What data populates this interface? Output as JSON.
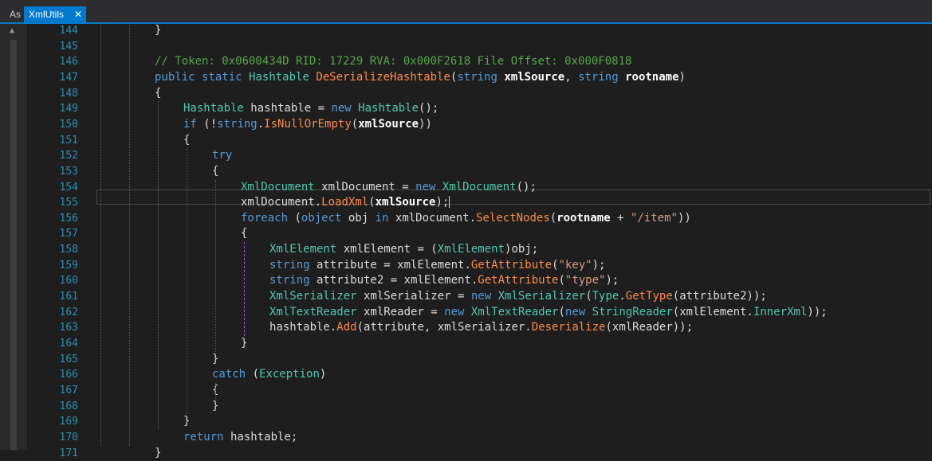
{
  "tabs": [
    {
      "label": "As",
      "active": false
    },
    {
      "label": "XmlUtils",
      "active": true
    }
  ],
  "tab_close_glyph": "✕",
  "colors": {
    "accent": "#007acc",
    "line_number": "#2b91af",
    "keyword": "#569cd6",
    "type": "#4ec9b0",
    "method": "#ff8c4b",
    "string": "#d69d85",
    "comment": "#57a64a"
  },
  "editor": {
    "current_line": 155,
    "lines": [
      {
        "n": "144",
        "indent": 2,
        "tokens": [
          [
            "p",
            "}"
          ]
        ]
      },
      {
        "n": "145",
        "indent": 0,
        "tokens": []
      },
      {
        "n": "146",
        "indent": 2,
        "tokens": [
          [
            "c",
            "// Token: 0x0600434D RID: 17229 RVA: 0x000F2618 File Offset: 0x000F0818"
          ]
        ]
      },
      {
        "n": "147",
        "indent": 2,
        "tokens": [
          [
            "k",
            "public"
          ],
          [
            "p",
            " "
          ],
          [
            "k",
            "static"
          ],
          [
            "p",
            " "
          ],
          [
            "t",
            "Hashtable"
          ],
          [
            "p",
            " "
          ],
          [
            "m",
            "DeSerializeHashtable"
          ],
          [
            "p",
            "("
          ],
          [
            "k",
            "string"
          ],
          [
            "p",
            " "
          ],
          [
            "b",
            "xmlSource"
          ],
          [
            "p",
            ", "
          ],
          [
            "k",
            "string"
          ],
          [
            "p",
            " "
          ],
          [
            "b",
            "rootname"
          ],
          [
            "p",
            ")"
          ]
        ]
      },
      {
        "n": "148",
        "indent": 2,
        "tokens": [
          [
            "p",
            "{"
          ]
        ]
      },
      {
        "n": "149",
        "indent": 3,
        "tokens": [
          [
            "t",
            "Hashtable"
          ],
          [
            "p",
            " hashtable = "
          ],
          [
            "k",
            "new"
          ],
          [
            "p",
            " "
          ],
          [
            "t",
            "Hashtable"
          ],
          [
            "p",
            "();"
          ]
        ]
      },
      {
        "n": "150",
        "indent": 3,
        "tokens": [
          [
            "k",
            "if"
          ],
          [
            "p",
            " (!"
          ],
          [
            "k",
            "string"
          ],
          [
            "p",
            "."
          ],
          [
            "m",
            "IsNullOrEmpty"
          ],
          [
            "p",
            "("
          ],
          [
            "b",
            "xmlSource"
          ],
          [
            "p",
            "))"
          ]
        ]
      },
      {
        "n": "151",
        "indent": 3,
        "tokens": [
          [
            "p",
            "{"
          ]
        ]
      },
      {
        "n": "152",
        "indent": 4,
        "tokens": [
          [
            "k",
            "try"
          ]
        ]
      },
      {
        "n": "153",
        "indent": 4,
        "tokens": [
          [
            "p",
            "{"
          ]
        ]
      },
      {
        "n": "154",
        "indent": 5,
        "tokens": [
          [
            "t",
            "XmlDocument"
          ],
          [
            "p",
            " xmlDocument = "
          ],
          [
            "k",
            "new"
          ],
          [
            "p",
            " "
          ],
          [
            "t",
            "XmlDocument"
          ],
          [
            "p",
            "();"
          ]
        ]
      },
      {
        "n": "155",
        "indent": 5,
        "tokens": [
          [
            "p",
            "xmlDocument."
          ],
          [
            "m",
            "LoadXml"
          ],
          [
            "p",
            "("
          ],
          [
            "b",
            "xmlSource"
          ],
          [
            "p",
            ");"
          ]
        ]
      },
      {
        "n": "156",
        "indent": 5,
        "tokens": [
          [
            "k",
            "foreach"
          ],
          [
            "p",
            " ("
          ],
          [
            "k",
            "object"
          ],
          [
            "p",
            " obj "
          ],
          [
            "k",
            "in"
          ],
          [
            "p",
            " xmlDocument."
          ],
          [
            "m",
            "SelectNodes"
          ],
          [
            "p",
            "("
          ],
          [
            "b",
            "rootname"
          ],
          [
            "p",
            " + "
          ],
          [
            "s",
            "\"/item\""
          ],
          [
            "p",
            "))"
          ]
        ]
      },
      {
        "n": "157",
        "indent": 5,
        "tokens": [
          [
            "p",
            "{"
          ]
        ]
      },
      {
        "n": "158",
        "indent": 6,
        "tokens": [
          [
            "t",
            "XmlElement"
          ],
          [
            "p",
            " xmlElement = ("
          ],
          [
            "t",
            "XmlElement"
          ],
          [
            "p",
            ")obj;"
          ]
        ]
      },
      {
        "n": "159",
        "indent": 6,
        "tokens": [
          [
            "k",
            "string"
          ],
          [
            "p",
            " attribute = xmlElement."
          ],
          [
            "m",
            "GetAttribute"
          ],
          [
            "p",
            "("
          ],
          [
            "s",
            "\"key\""
          ],
          [
            "p",
            ");"
          ]
        ]
      },
      {
        "n": "160",
        "indent": 6,
        "tokens": [
          [
            "k",
            "string"
          ],
          [
            "p",
            " attribute2 = xmlElement."
          ],
          [
            "m",
            "GetAttribute"
          ],
          [
            "p",
            "("
          ],
          [
            "s",
            "\"type\""
          ],
          [
            "p",
            ");"
          ]
        ]
      },
      {
        "n": "161",
        "indent": 6,
        "tokens": [
          [
            "t",
            "XmlSerializer"
          ],
          [
            "p",
            " xmlSerializer = "
          ],
          [
            "k",
            "new"
          ],
          [
            "p",
            " "
          ],
          [
            "t",
            "XmlSerializer"
          ],
          [
            "p",
            "("
          ],
          [
            "t",
            "Type"
          ],
          [
            "p",
            "."
          ],
          [
            "m",
            "GetType"
          ],
          [
            "p",
            "(attribute2));"
          ]
        ]
      },
      {
        "n": "162",
        "indent": 6,
        "tokens": [
          [
            "t",
            "XmlTextReader"
          ],
          [
            "p",
            " xmlReader = "
          ],
          [
            "k",
            "new"
          ],
          [
            "p",
            " "
          ],
          [
            "t",
            "XmlTextReader"
          ],
          [
            "p",
            "("
          ],
          [
            "k",
            "new"
          ],
          [
            "p",
            " "
          ],
          [
            "t",
            "StringReader"
          ],
          [
            "p",
            "(xmlElement."
          ],
          [
            "r",
            "InnerXml"
          ],
          [
            "p",
            "));"
          ]
        ]
      },
      {
        "n": "163",
        "indent": 6,
        "tokens": [
          [
            "p",
            "hashtable."
          ],
          [
            "m",
            "Add"
          ],
          [
            "p",
            "(attribute, xmlSerializer."
          ],
          [
            "m",
            "Deserialize"
          ],
          [
            "p",
            "(xmlReader));"
          ]
        ]
      },
      {
        "n": "164",
        "indent": 5,
        "tokens": [
          [
            "p",
            "}"
          ]
        ]
      },
      {
        "n": "165",
        "indent": 4,
        "tokens": [
          [
            "p",
            "}"
          ]
        ]
      },
      {
        "n": "166",
        "indent": 4,
        "tokens": [
          [
            "k",
            "catch"
          ],
          [
            "p",
            " ("
          ],
          [
            "t",
            "Exception"
          ],
          [
            "p",
            ")"
          ]
        ]
      },
      {
        "n": "167",
        "indent": 4,
        "tokens": [
          [
            "p",
            "{"
          ]
        ]
      },
      {
        "n": "168",
        "indent": 4,
        "tokens": [
          [
            "p",
            "}"
          ]
        ]
      },
      {
        "n": "169",
        "indent": 3,
        "tokens": [
          [
            "p",
            "}"
          ]
        ]
      },
      {
        "n": "170",
        "indent": 3,
        "tokens": [
          [
            "k",
            "return"
          ],
          [
            "p",
            " hashtable;"
          ]
        ]
      },
      {
        "n": "171",
        "indent": 2,
        "tokens": [
          [
            "p",
            "}"
          ]
        ]
      }
    ]
  }
}
